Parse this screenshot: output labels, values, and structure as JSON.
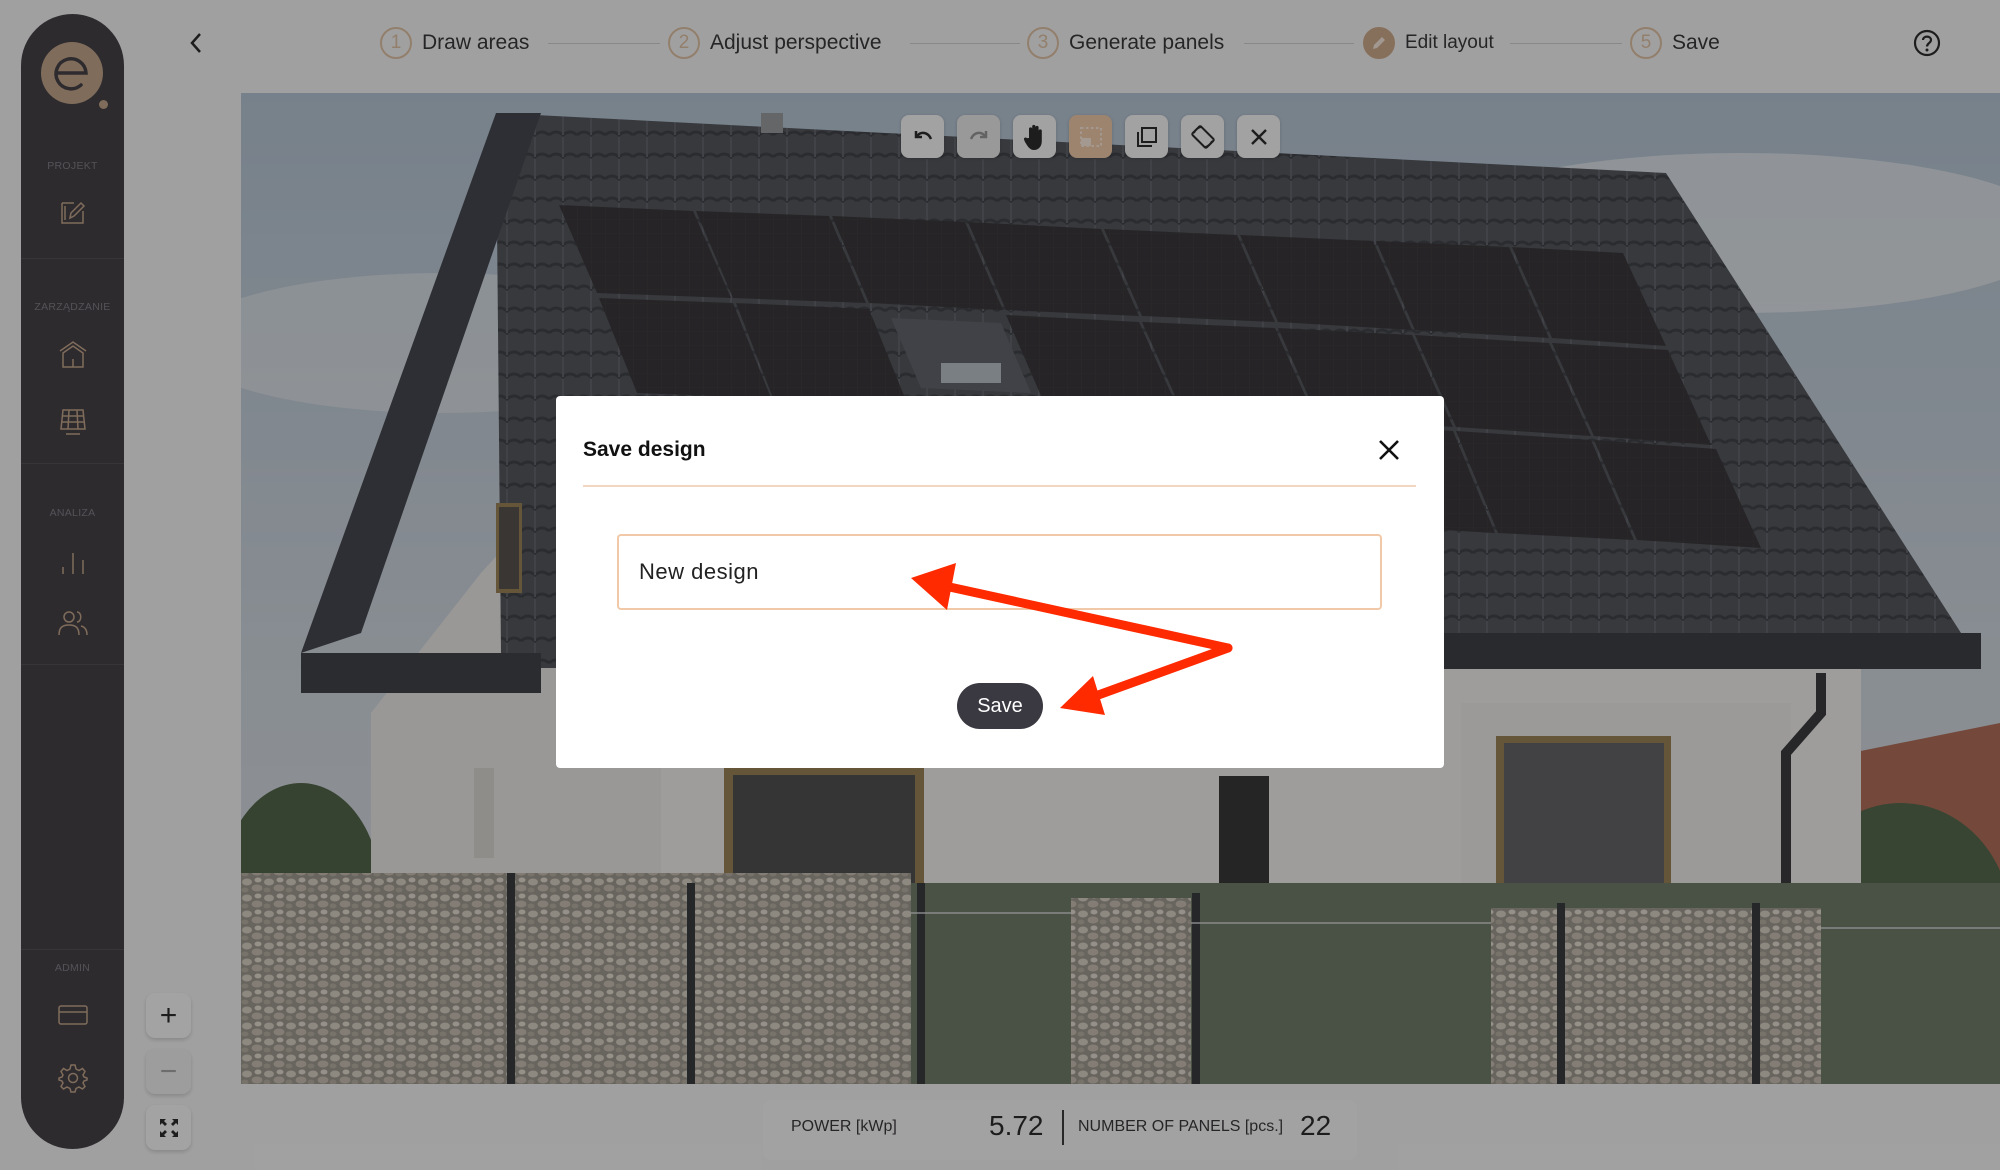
{
  "sidebar": {
    "logo_letter": "e",
    "sections": [
      {
        "label": "PROJEKT",
        "items": [
          {
            "icon": "edit-project-icon"
          }
        ]
      },
      {
        "label": "ZARZĄDZANIE",
        "items": [
          {
            "icon": "home-icon"
          },
          {
            "icon": "solar-panel-icon"
          }
        ]
      },
      {
        "label": "ANALIZA",
        "items": [
          {
            "icon": "bar-chart-icon"
          },
          {
            "icon": "users-icon"
          }
        ]
      },
      {
        "label": "ADMIN",
        "items": [
          {
            "icon": "credit-card-icon"
          },
          {
            "icon": "gear-icon"
          }
        ]
      }
    ]
  },
  "stepper": {
    "back_icon": "chevron-left-icon",
    "steps": [
      {
        "number": "1",
        "label": "Draw areas",
        "state": "done"
      },
      {
        "number": "2",
        "label": "Adjust perspective",
        "state": "done"
      },
      {
        "number": "3",
        "label": "Generate panels",
        "state": "done"
      },
      {
        "number": "",
        "label": "Edit layout",
        "state": "active",
        "icon": "pencil-icon"
      },
      {
        "number": "5",
        "label": "Save",
        "state": "pending"
      }
    ],
    "help_icon": "help-circle-icon"
  },
  "toolbar": {
    "tools": [
      {
        "name": "undo",
        "icon": "undo-icon",
        "state": "enabled"
      },
      {
        "name": "redo",
        "icon": "redo-icon",
        "state": "disabled"
      },
      {
        "name": "pan",
        "icon": "hand-icon",
        "state": "enabled"
      },
      {
        "name": "select-area",
        "icon": "select-area-icon",
        "state": "active"
      },
      {
        "name": "duplicate",
        "icon": "copy-icon",
        "state": "enabled"
      },
      {
        "name": "rotate",
        "icon": "rotate-icon",
        "state": "enabled"
      },
      {
        "name": "delete",
        "icon": "close-icon",
        "state": "enabled"
      }
    ]
  },
  "zoom_controls": {
    "zoom_in": "+",
    "zoom_out": "−",
    "fit_icon": "fullscreen-icon"
  },
  "stats": {
    "power_label": "POWER [kWp]",
    "power_value": "5.72",
    "panels_label": "NUMBER OF PANELS [pcs.]",
    "panels_value": "22"
  },
  "modal": {
    "title": "Save design",
    "input_value": "New design",
    "save_label": "Save"
  },
  "colors": {
    "accent": "#c59f7a",
    "sidebar_bg": "#2b2930",
    "button_dark": "#3a3840",
    "input_border": "#f1c9a9",
    "annotation_arrow": "#ff2a00"
  }
}
